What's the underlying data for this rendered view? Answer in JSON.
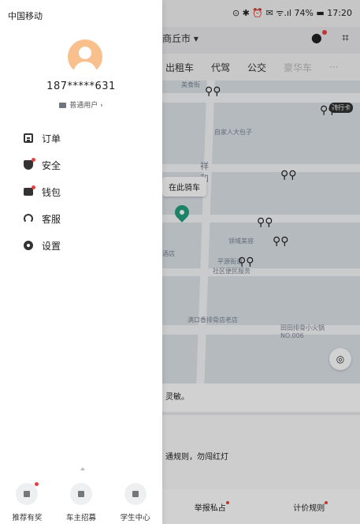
{
  "status_bar": {
    "carrier": "中国移动",
    "battery": "74%",
    "time": "17:20",
    "right_text": "⊙ ✱ ⏰ ✉ ᯤ.ıl 74% ▬ 17:20"
  },
  "background": {
    "city": "商丘市 ▾",
    "tabs": [
      "出租车",
      "代驾",
      "公交",
      "豪华车",
      "···"
    ],
    "map_labels": [
      "美食街",
      "自家人大包子",
      "祥和",
      "领域美容",
      "平源街道",
      "社区便民服务",
      "酒店",
      "满口香排骨店老店",
      "田田排骨小火锅NO.006",
      "骑行卡"
    ],
    "bubble": "在此骑车",
    "panel_notice": "灵敏。",
    "panel_rule": "通规则，勿闯红灯",
    "bottom_left": "举报私占",
    "bottom_right": "计价规则"
  },
  "drawer": {
    "phone": "187*****631",
    "level": "普通用户 ›",
    "menu": [
      {
        "label": "订单",
        "icon": "order-icon",
        "badge": false
      },
      {
        "label": "安全",
        "icon": "shield-icon",
        "badge": true
      },
      {
        "label": "钱包",
        "icon": "wallet-icon",
        "badge": true
      },
      {
        "label": "客服",
        "icon": "headset-icon",
        "badge": false
      },
      {
        "label": "设置",
        "icon": "gear-icon",
        "badge": false
      }
    ],
    "bottom": [
      {
        "label": "推荐有奖",
        "icon": "gift-icon",
        "badge": true
      },
      {
        "label": "车主招募",
        "icon": "car-icon",
        "badge": false
      },
      {
        "label": "学生中心",
        "icon": "graduation-cap-icon",
        "badge": false
      }
    ]
  },
  "colors": {
    "accent_red": "#e64340",
    "avatar": "#f9c08d",
    "pin_green": "#22a07f"
  }
}
